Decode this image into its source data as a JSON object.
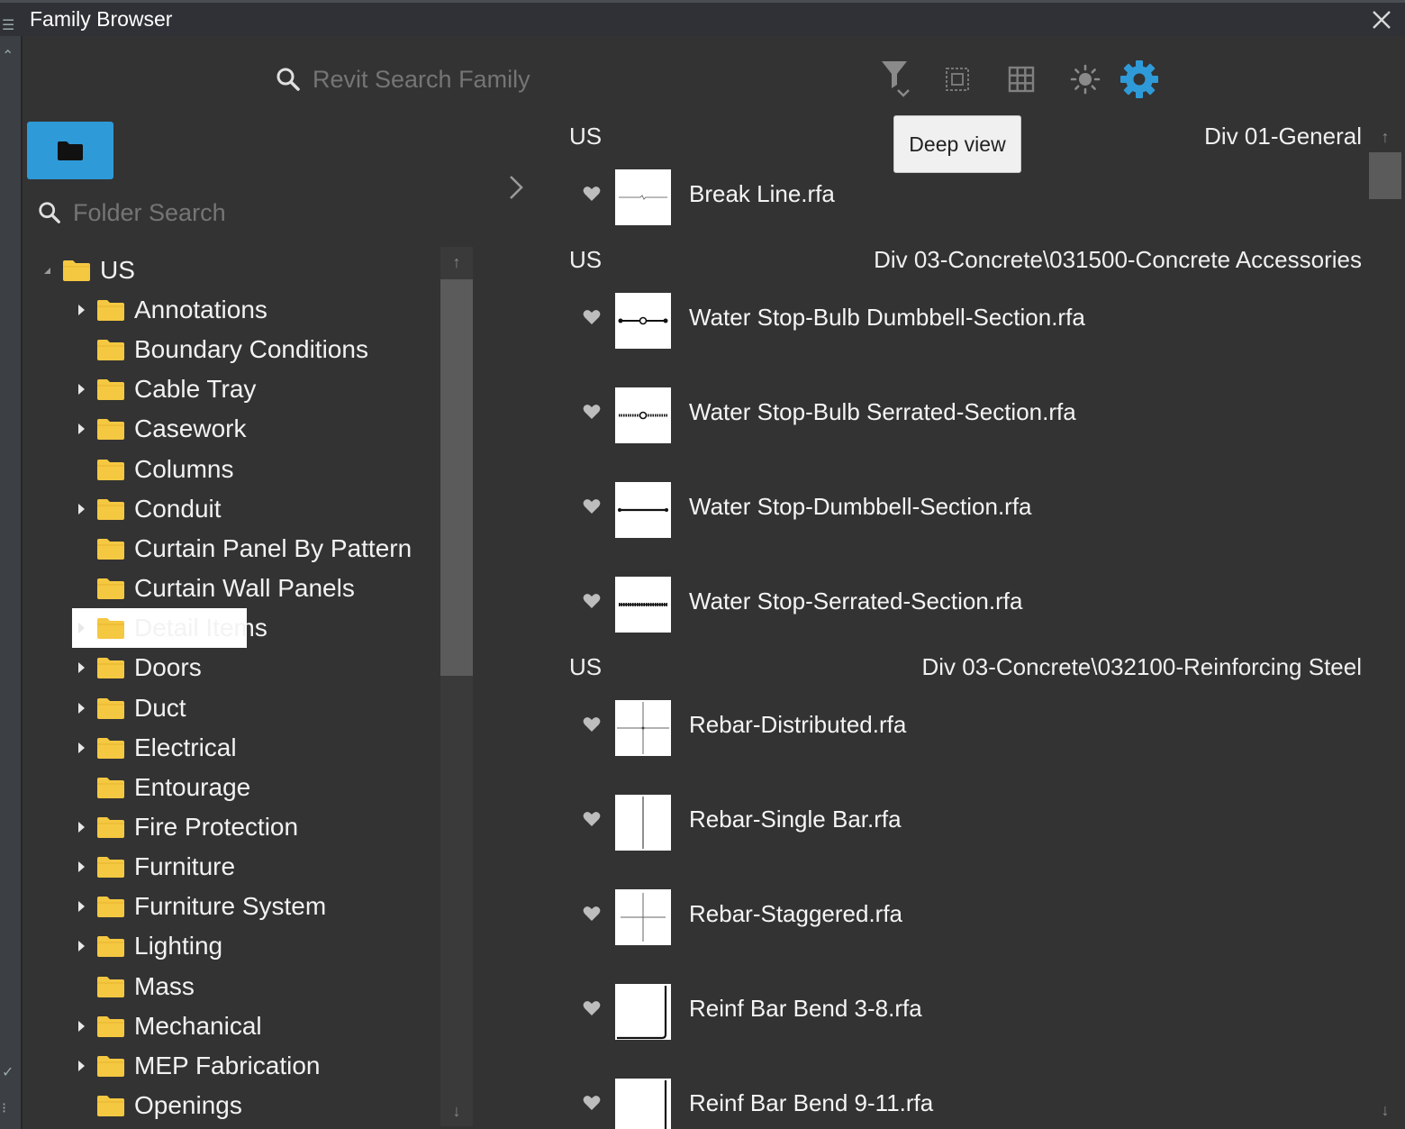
{
  "window": {
    "title": "Family Browser"
  },
  "search": {
    "placeholder": "Revit Search Family"
  },
  "toolbar": {
    "tooltip": "Deep view",
    "accent_color": "#2f9ad8",
    "icons": [
      "filter-icon",
      "deep-view-icon",
      "grid-icon",
      "theme-sun-icon",
      "settings-gear-icon"
    ]
  },
  "folder_panel": {
    "search_placeholder": "Folder Search",
    "root": "US",
    "folders": [
      {
        "label": "Annotations",
        "expandable": true
      },
      {
        "label": "Boundary Conditions",
        "expandable": false
      },
      {
        "label": "Cable Tray",
        "expandable": true
      },
      {
        "label": "Casework",
        "expandable": true
      },
      {
        "label": "Columns",
        "expandable": false
      },
      {
        "label": "Conduit",
        "expandable": true
      },
      {
        "label": "Curtain Panel By Pattern",
        "expandable": false
      },
      {
        "label": "Curtain Wall Panels",
        "expandable": false
      },
      {
        "label": "Detail Items",
        "expandable": true,
        "selected": true
      },
      {
        "label": "Doors",
        "expandable": true
      },
      {
        "label": "Duct",
        "expandable": true
      },
      {
        "label": "Electrical",
        "expandable": true
      },
      {
        "label": "Entourage",
        "expandable": false
      },
      {
        "label": "Fire Protection",
        "expandable": true
      },
      {
        "label": "Furniture",
        "expandable": true
      },
      {
        "label": "Furniture System",
        "expandable": true
      },
      {
        "label": "Lighting",
        "expandable": true
      },
      {
        "label": "Mass",
        "expandable": false
      },
      {
        "label": "Mechanical",
        "expandable": true
      },
      {
        "label": "MEP Fabrication",
        "expandable": true
      },
      {
        "label": "Openings",
        "expandable": false
      }
    ]
  },
  "results": {
    "groups": [
      {
        "left": "US",
        "right": "Div 01-General",
        "items": [
          {
            "name": "Break Line.rfa",
            "thumb": "break-line"
          }
        ]
      },
      {
        "left": "US",
        "right": "Div 03-Concrete\\031500-Concrete Accessories",
        "items": [
          {
            "name": "Water Stop-Bulb Dumbbell-Section.rfa",
            "thumb": "bulb-dumbbell"
          },
          {
            "name": "Water Stop-Bulb Serrated-Section.rfa",
            "thumb": "bulb-serrated"
          },
          {
            "name": "Water Stop-Dumbbell-Section.rfa",
            "thumb": "dumbbell"
          },
          {
            "name": "Water Stop-Serrated-Section.rfa",
            "thumb": "serrated"
          }
        ]
      },
      {
        "left": "US",
        "right": "Div 03-Concrete\\032100-Reinforcing Steel",
        "items": [
          {
            "name": "Rebar-Distributed.rfa",
            "thumb": "cross"
          },
          {
            "name": "Rebar-Single Bar.rfa",
            "thumb": "vline"
          },
          {
            "name": "Rebar-Staggered.rfa",
            "thumb": "cross-small"
          },
          {
            "name": "Reinf Bar Bend 3-8.rfa",
            "thumb": "bend"
          },
          {
            "name": "Reinf Bar Bend 9-11.rfa",
            "thumb": "bend2"
          }
        ]
      }
    ]
  }
}
